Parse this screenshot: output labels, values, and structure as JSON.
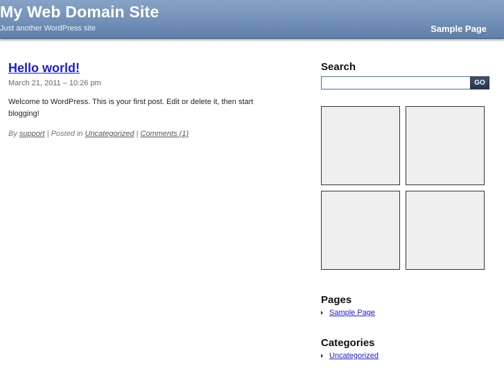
{
  "header": {
    "site_title": "My Web Domain Site",
    "site_description": "Just another WordPress site",
    "nav": [
      {
        "label": "Sample Page"
      }
    ]
  },
  "post": {
    "title": "Hello world!",
    "date": "March 21, 2011 – 10:26 pm",
    "body": "Welcome to WordPress. This is your first post. Edit or delete it, then start blogging!",
    "meta": {
      "by_prefix": "By ",
      "author": "support",
      "posted_prefix": " | Posted in ",
      "category": "Uncategorized",
      "separator": " | ",
      "comments": "Comments (1)"
    }
  },
  "sidebar": {
    "search": {
      "title": "Search",
      "input_value": "",
      "button_label": "GO"
    },
    "pages": {
      "title": "Pages",
      "items": [
        {
          "label": "Sample Page"
        }
      ]
    },
    "categories": {
      "title": "Categories",
      "items": [
        {
          "label": "Uncategorized"
        }
      ]
    }
  },
  "colors": {
    "header_gradient_top": "#86a3c6",
    "header_gradient_bottom": "#5f7ea9",
    "link": "#1a1ad4",
    "ad_placeholder": "#efefef"
  }
}
